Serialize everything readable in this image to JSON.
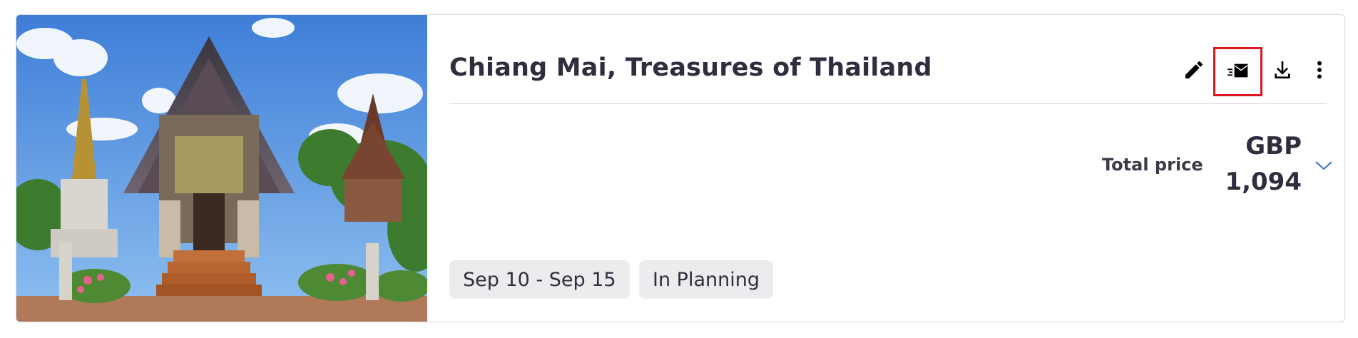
{
  "trip": {
    "title": "Chiang Mai, Treasures of Thailand",
    "image_subject": "temple-photo"
  },
  "actions": [
    {
      "name": "edit",
      "icon": "pencil-icon"
    },
    {
      "name": "email",
      "icon": "email-send-icon",
      "highlighted": true
    },
    {
      "name": "download",
      "icon": "download-icon"
    },
    {
      "name": "more",
      "icon": "more-vert-icon"
    }
  ],
  "price": {
    "label": "Total price",
    "currency": "GBP",
    "amount": "1,094"
  },
  "tags": {
    "dates": "Sep 10 - Sep 15",
    "status": "In Planning"
  },
  "colors": {
    "highlight": "#e0141e",
    "tag_bg": "#ececef",
    "chevron": "#3b6fd8",
    "text": "#2e2e3e"
  }
}
